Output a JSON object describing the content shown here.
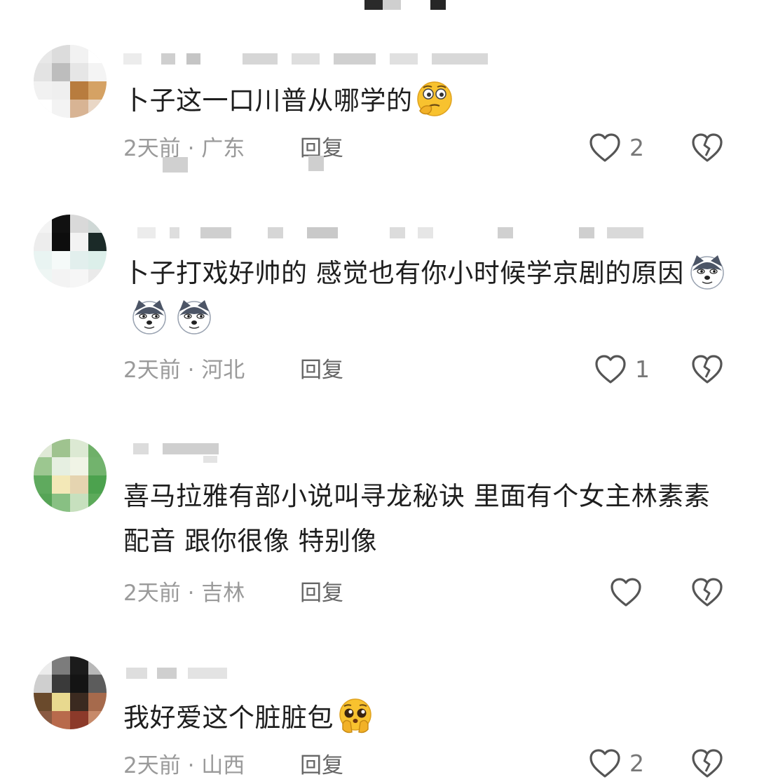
{
  "comments": [
    {
      "text": "卜子这一口川普从哪学的",
      "emoji": "thinking-face-emoji",
      "time": "2天前",
      "location": "广东",
      "reply_label": "回复",
      "likes": "2"
    },
    {
      "text": "卜子打戏好帅的 感觉也有你小时候学京剧的原因",
      "emoji": "dog-face-emoji",
      "time": "2天前",
      "location": "河北",
      "reply_label": "回复",
      "likes": "1"
    },
    {
      "text": "喜马拉雅有部小说叫寻龙秘诀 里面有个女主林素素 配音 跟你很像 特别像",
      "time": "2天前",
      "location": "吉林",
      "reply_label": "回复",
      "likes": ""
    },
    {
      "text": "我好爱这个脏脏包",
      "emoji": "pleading-face-emoji",
      "time": "2天前",
      "location": "山西",
      "reply_label": "回复",
      "likes": "2"
    }
  ],
  "colors": {
    "meta_text": "#9a9a9a",
    "reply_text": "#666666",
    "icon_stroke": "#555555"
  },
  "icons": {
    "like": "heart-outline-icon",
    "dislike": "broken-heart-icon"
  }
}
